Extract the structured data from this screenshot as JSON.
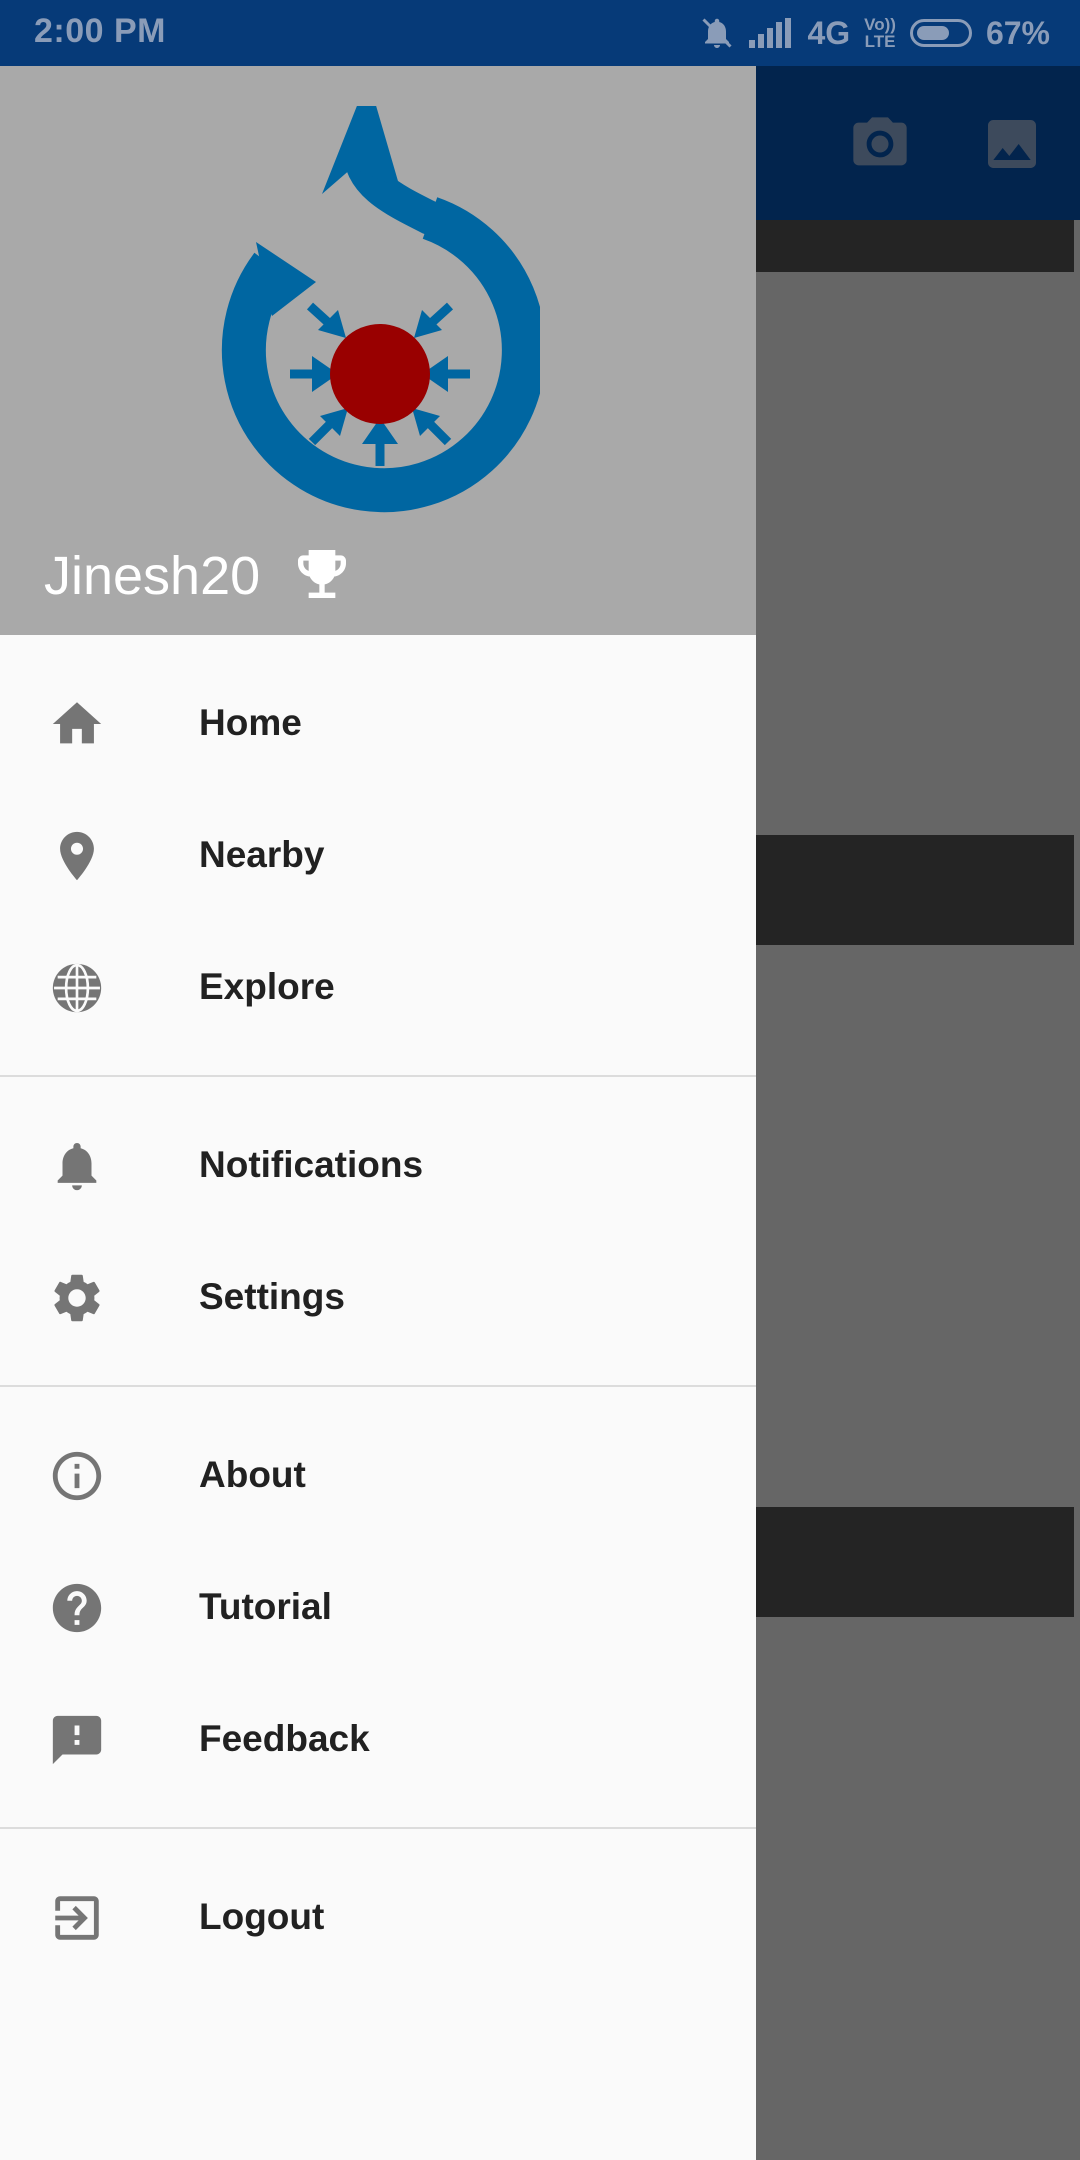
{
  "status_bar": {
    "time": "2:00 PM",
    "network": "4G",
    "volte_top": "Vo))",
    "volte_bottom": "LTE",
    "battery_percent": "67%",
    "battery_level": 0.67
  },
  "app_bar": {
    "icons": [
      "camera-icon",
      "gallery-icon"
    ]
  },
  "drawer": {
    "username": "Jinesh20",
    "achievements_icon": "trophy-icon",
    "logo": "commons-logo",
    "groups": [
      [
        {
          "label": "Home",
          "icon": "home-icon"
        },
        {
          "label": "Nearby",
          "icon": "location-pin-icon"
        },
        {
          "label": "Explore",
          "icon": "globe-icon"
        }
      ],
      [
        {
          "label": "Notifications",
          "icon": "bell-icon"
        },
        {
          "label": "Settings",
          "icon": "gear-icon"
        }
      ],
      [
        {
          "label": "About",
          "icon": "info-icon"
        },
        {
          "label": "Tutorial",
          "icon": "help-icon"
        },
        {
          "label": "Feedback",
          "icon": "feedback-icon"
        }
      ],
      [
        {
          "label": "Logout",
          "icon": "logout-icon"
        }
      ]
    ]
  },
  "colors": {
    "status_bar": "#063a78",
    "app_bar": "#02244d",
    "drawer_header": "#a9a9a9",
    "logo_blue": "#0066a1",
    "logo_red": "#990000",
    "icon_gray": "#757575",
    "text": "#212121"
  }
}
